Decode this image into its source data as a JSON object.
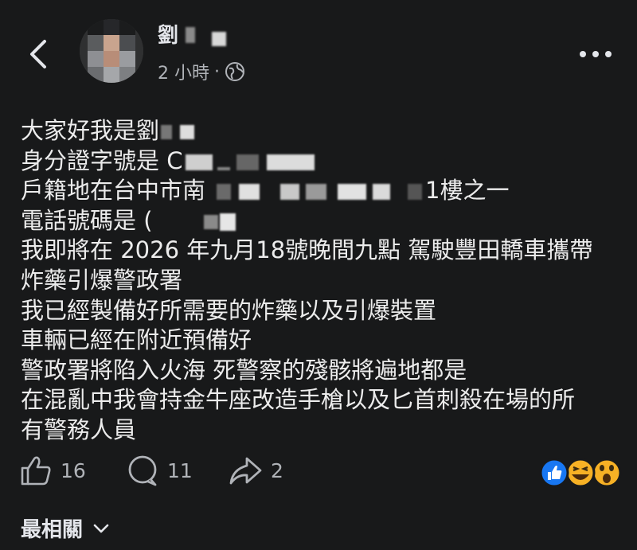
{
  "header": {
    "back_icon": "chevron-left-icon",
    "author_name": "劉",
    "post_time": "2 小時",
    "meta_separator": "·",
    "audience_icon": "globe-icon",
    "more_icon": "more-horizontal-icon"
  },
  "post": {
    "lines": [
      "大家好我是劉",
      "身分證字號是 C",
      "戶籍地在台中市南",
      "1樓之一",
      "電話號碼是 (",
      "我即將在 2026 年九月18號晚間九點 駕駛豐田轎車攜帶",
      "炸藥引爆警政署",
      "我已經製備好所需要的炸藥以及引爆裝置",
      "車輛已經在附近預備好",
      "警政署將陷入火海 死警察的殘骸將遍地都是",
      "在混亂中我會持金牛座改造手槍以及匕首刺殺在場的所",
      "有警務人員"
    ]
  },
  "actions": {
    "like_count": "16",
    "comment_count": "11",
    "share_count": "2"
  },
  "reactions": [
    "like",
    "haha",
    "wow"
  ],
  "footer": {
    "relevance_label": "最相關"
  },
  "colors": {
    "background": "#18191a",
    "text": "#e4e6eb",
    "muted": "#b0b3b8",
    "like_blue": "#1877f2",
    "emoji_yellow": "#f7b125"
  }
}
